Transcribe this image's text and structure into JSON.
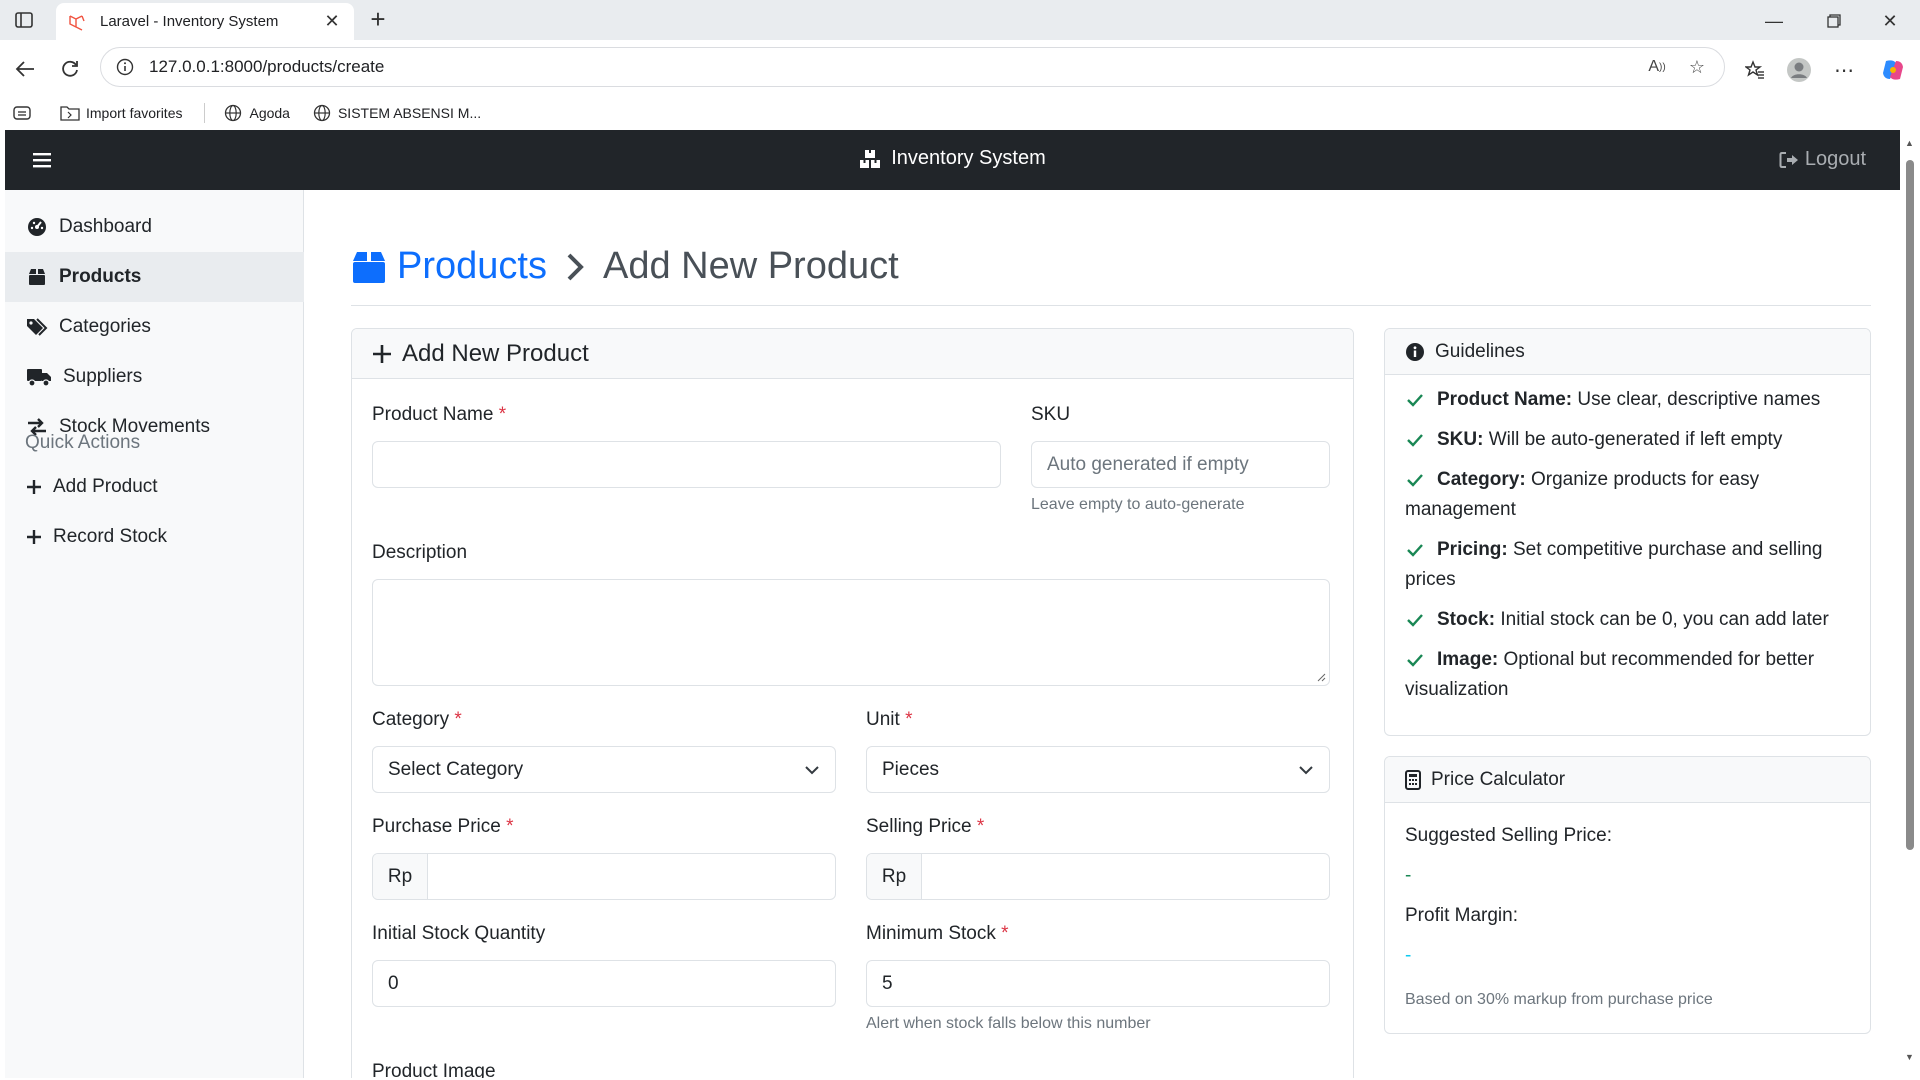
{
  "browser": {
    "tab_title": "Laravel - Inventory System",
    "url": "127.0.0.1:8000/products/create",
    "bookmarks": [
      "Import favorites",
      "Agoda",
      "SISTEM ABSENSI M..."
    ]
  },
  "app": {
    "brand": "Inventory System",
    "logout": "Logout"
  },
  "sidebar": {
    "items": [
      {
        "label": "Dashboard",
        "icon": "dashboard-icon"
      },
      {
        "label": "Products",
        "icon": "box-icon",
        "active": true
      },
      {
        "label": "Categories",
        "icon": "tags-icon"
      },
      {
        "label": "Suppliers",
        "icon": "truck-icon"
      },
      {
        "label": "Stock Movements",
        "icon": "exchange-icon"
      }
    ],
    "quick_actions_heading": "Quick Actions",
    "quick_actions": [
      {
        "label": "Add Product",
        "icon": "plus-icon"
      },
      {
        "label": "Record Stock",
        "icon": "plus-icon"
      }
    ]
  },
  "breadcrumb": {
    "parent": "Products",
    "current": "Add New Product"
  },
  "form": {
    "header": "Add New Product",
    "required_mark": "*",
    "product_name_label": "Product Name",
    "product_name_value": "",
    "sku_label": "SKU",
    "sku_placeholder": "Auto generated if empty",
    "sku_help": "Leave empty to auto-generate",
    "description_label": "Description",
    "category_label": "Category",
    "category_value": "Select Category",
    "unit_label": "Unit",
    "unit_value": "Pieces",
    "purchase_price_label": "Purchase Price",
    "selling_price_label": "Selling Price",
    "currency": "Rp",
    "initial_stock_label": "Initial Stock Quantity",
    "initial_stock_value": "0",
    "minimum_stock_label": "Minimum Stock",
    "minimum_stock_value": "5",
    "minimum_stock_help": "Alert when stock falls below this number",
    "product_image_label": "Product Image"
  },
  "guidelines": {
    "title": "Guidelines",
    "items": [
      {
        "key": "Product Name:",
        "text": " Use clear, descriptive names"
      },
      {
        "key": "SKU:",
        "text": " Will be auto-generated if left empty"
      },
      {
        "key": "Category:",
        "text": " Organize products for easy management"
      },
      {
        "key": "Pricing:",
        "text": " Set competitive purchase and selling prices"
      },
      {
        "key": "Stock:",
        "text": " Initial stock can be 0, you can add later"
      },
      {
        "key": "Image:",
        "text": " Optional but recommended for better visualization"
      }
    ]
  },
  "calculator": {
    "title": "Price Calculator",
    "suggested_label": "Suggested Selling Price:",
    "suggested_value": "-",
    "margin_label": "Profit Margin:",
    "margin_value": "-",
    "note": "Based on 30% markup from purchase price"
  },
  "colors": {
    "primary": "#0d6efd",
    "navbar": "#212529",
    "success": "#198754",
    "danger": "#dc3545",
    "info": "#0dcaf0"
  }
}
